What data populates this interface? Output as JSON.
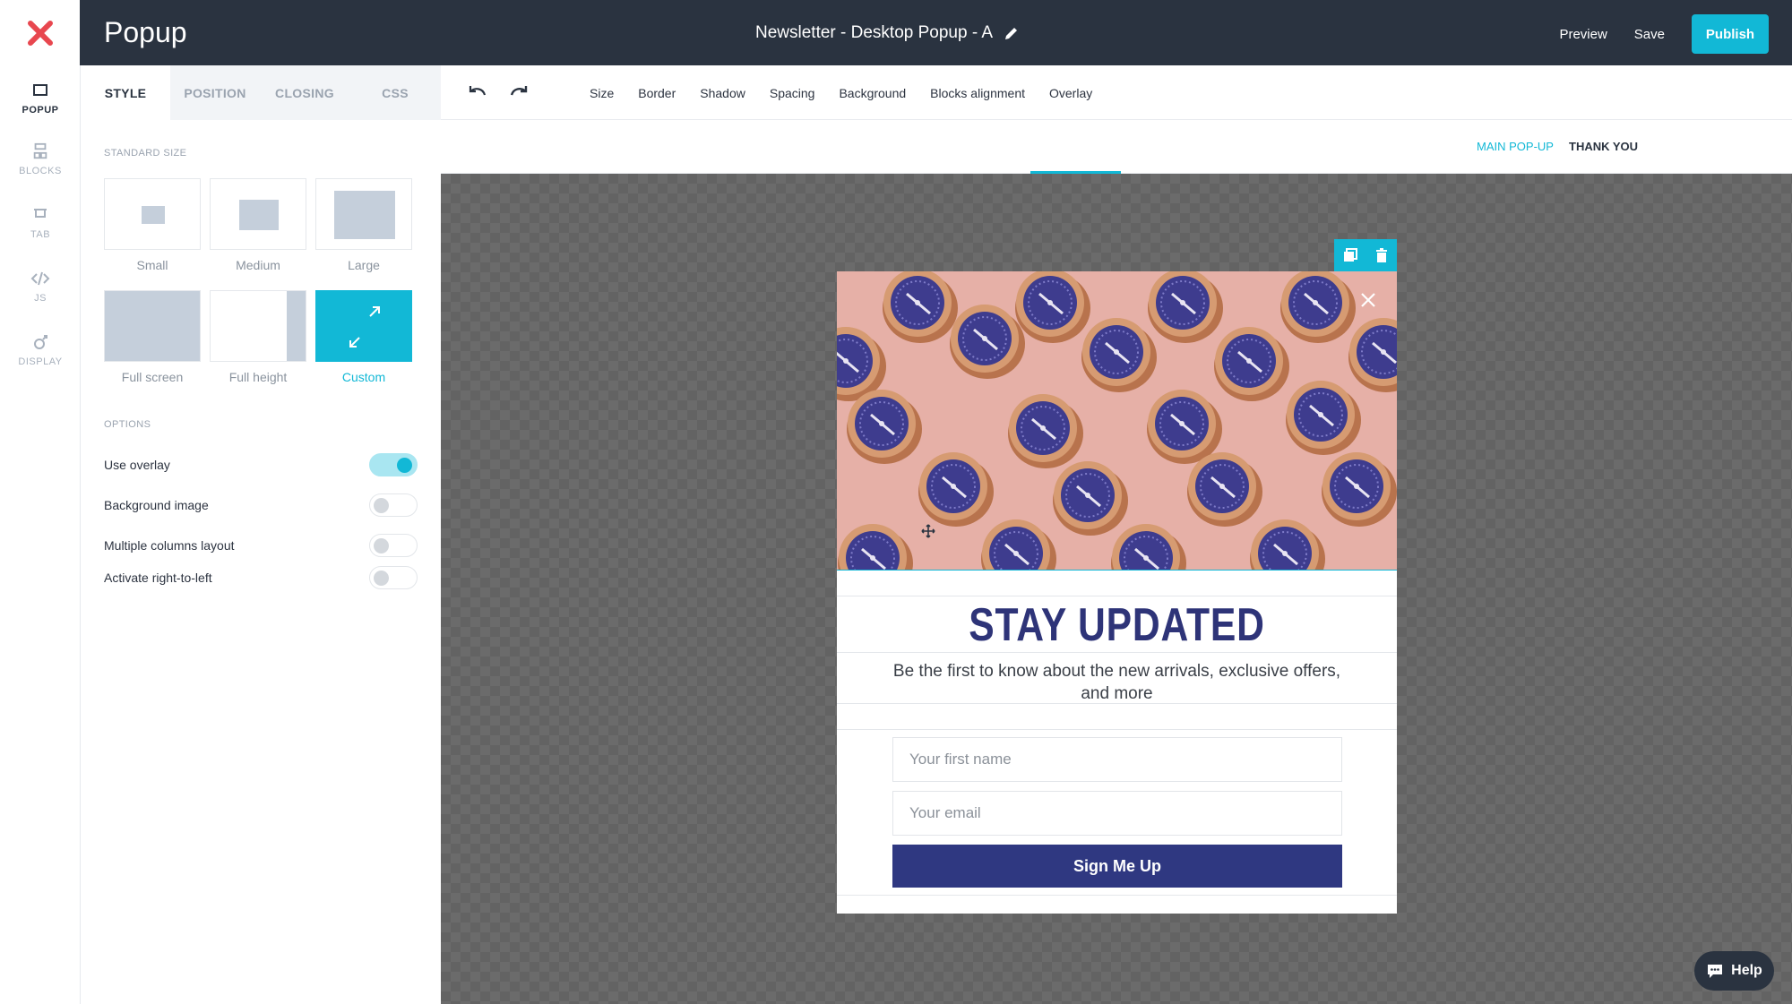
{
  "app": {
    "title": "Popup"
  },
  "header": {
    "document_title": "Newsletter - Desktop Popup - A",
    "preview_label": "Preview",
    "save_label": "Save",
    "publish_label": "Publish"
  },
  "rail": {
    "items": [
      {
        "label": "POPUP",
        "icon": "popup-icon",
        "active": true
      },
      {
        "label": "BLOCKS",
        "icon": "blocks-icon",
        "active": false
      },
      {
        "label": "TAB",
        "icon": "tab-icon",
        "active": false
      },
      {
        "label": "JS",
        "icon": "code-icon",
        "active": false
      },
      {
        "label": "DISPLAY",
        "icon": "display-icon",
        "active": false
      }
    ]
  },
  "panel": {
    "tabs": [
      {
        "label": "STYLE",
        "active": true
      },
      {
        "label": "POSITION",
        "active": false
      },
      {
        "label": "CLOSING",
        "active": false
      },
      {
        "label": "CSS",
        "active": false
      }
    ],
    "standard_size_label": "STANDARD SIZE",
    "sizes": [
      {
        "label": "Small",
        "selected": false
      },
      {
        "label": "Medium",
        "selected": false
      },
      {
        "label": "Large",
        "selected": false
      },
      {
        "label": "Full screen",
        "selected": false
      },
      {
        "label": "Full height",
        "selected": false
      },
      {
        "label": "Custom",
        "selected": true
      }
    ],
    "options_label": "OPTIONS",
    "options": [
      {
        "label": "Use overlay",
        "on": true
      },
      {
        "label": "Background image",
        "on": false
      },
      {
        "label": "Multiple columns layout",
        "on": false
      },
      {
        "label": "Activate right-to-left",
        "on": false
      }
    ]
  },
  "toolbar": {
    "items": [
      "Size",
      "Border",
      "Shadow",
      "Spacing",
      "Background",
      "Blocks alignment",
      "Overlay"
    ]
  },
  "subtabs": {
    "main": "MAIN POP-UP",
    "thank_you": "THANK YOU"
  },
  "popup": {
    "heading": "STAY UPDATED",
    "subtext": "Be the first to know about the new arrivals, exclusive offers, and more",
    "first_name_placeholder": "Your first name",
    "email_placeholder": "Your email",
    "button_label": "Sign Me Up"
  },
  "help": {
    "label": "Help"
  },
  "colors": {
    "accent": "#12b8d6",
    "topbar": "#2a3340",
    "brand_logo": "#e8474f",
    "popup_heading": "#2e3478",
    "popup_button": "#2f3881"
  }
}
